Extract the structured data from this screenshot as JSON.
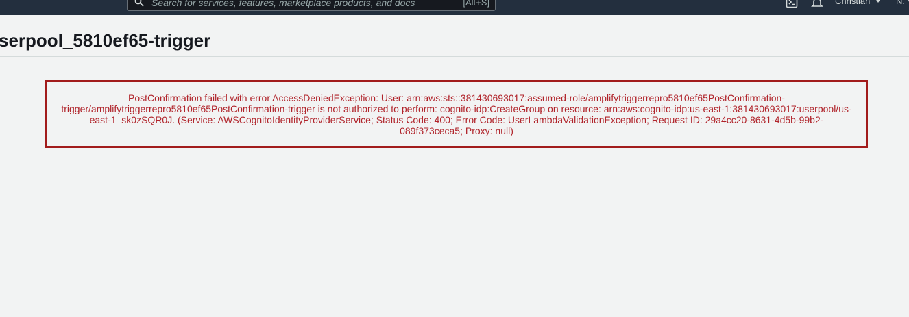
{
  "topbar": {
    "search": {
      "placeholder": "Search for services, features, marketplace products, and docs",
      "shortcut": "[Alt+S]",
      "icon": "search-icon"
    },
    "icons": [
      "cloudshell-icon",
      "bell-icon"
    ],
    "user": "Christian",
    "region": "N. V"
  },
  "page": {
    "title": "serpool_5810ef65-trigger"
  },
  "error": {
    "message": "PostConfirmation failed with error AccessDeniedException: User: arn:aws:sts::381430693017:assumed-role/amplifytriggerrepro5810ef65PostConfirmation-trigger/amplifytriggerrepro5810ef65PostConfirmation-trigger is not authorized to perform: cognito-idp:CreateGroup on resource: arn:aws:cognito-idp:us-east-1:381430693017:userpool/us-east-1_sk0zSQR0J. (Service: AWSCognitoIdentityProviderService; Status Code: 400; Error Code: UserLambdaValidationException; Request ID: 29a4cc20-8631-4d5b-99b2-089f373ceca5; Proxy: null)",
    "color": "#b0232a",
    "border_color": "#a21b1b"
  }
}
